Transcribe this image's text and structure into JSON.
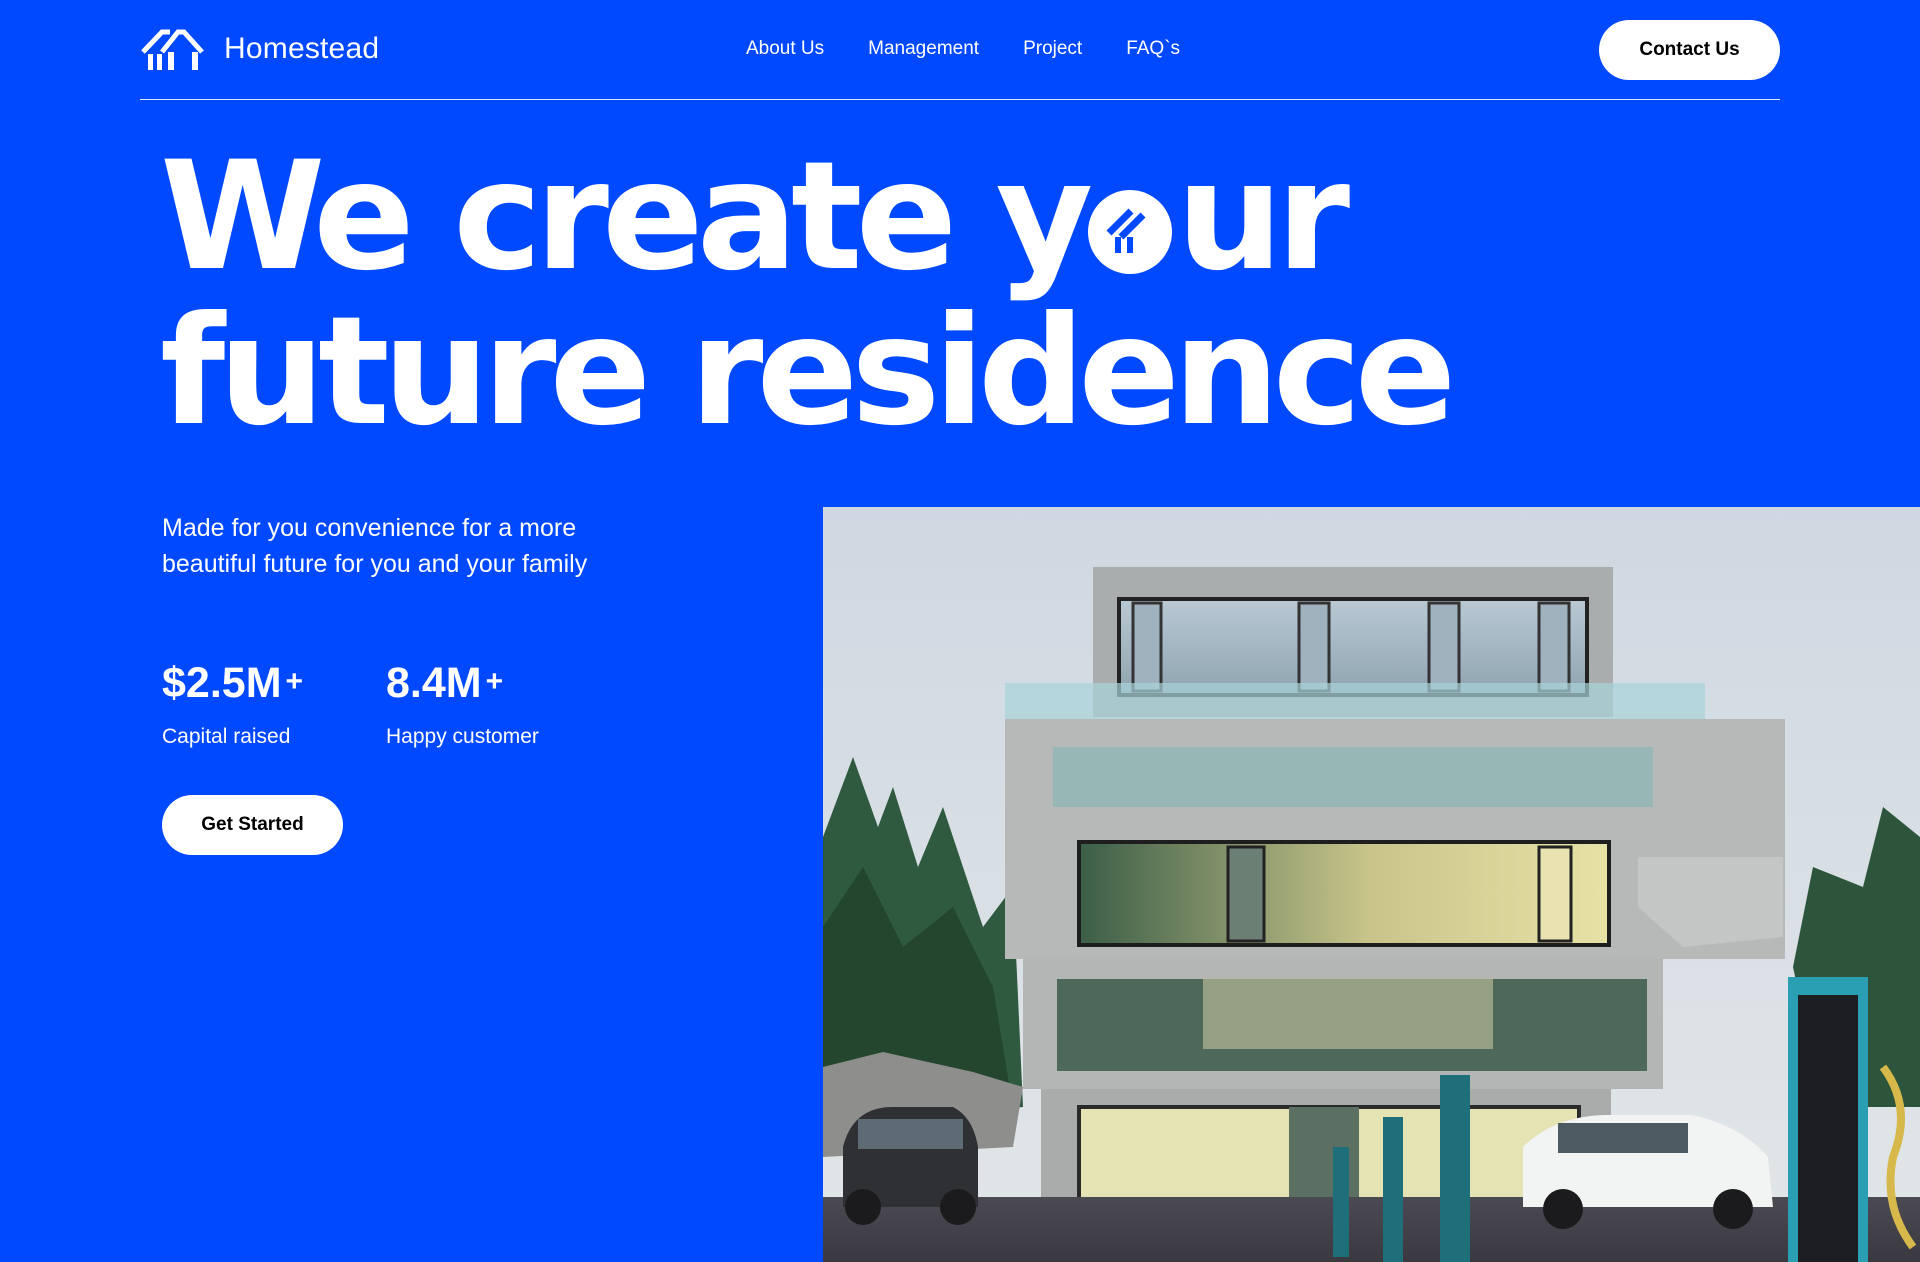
{
  "brand": {
    "name": "Homestead",
    "logo_icon": "house-logo-icon"
  },
  "nav": {
    "items": [
      "About Us",
      "Management",
      "Project",
      "FAQ`s"
    ]
  },
  "header": {
    "contact_label": "Contact Us"
  },
  "hero": {
    "headline_line1_a": "We create y",
    "headline_line1_b": "ur",
    "headline_line2": "future residence",
    "subtitle": "Made for you convenience for a more beautiful future for you and your family",
    "stats": [
      {
        "value": "$2.5M",
        "suffix": "+",
        "label": "Capital raised"
      },
      {
        "value": "8.4M",
        "suffix": "+",
        "label": "Happy customer"
      }
    ],
    "cta_label": "Get Started"
  },
  "colors": {
    "background": "#0049FF",
    "text": "#FFFFFF",
    "button_bg": "#FFFFFF",
    "button_text": "#000000"
  }
}
